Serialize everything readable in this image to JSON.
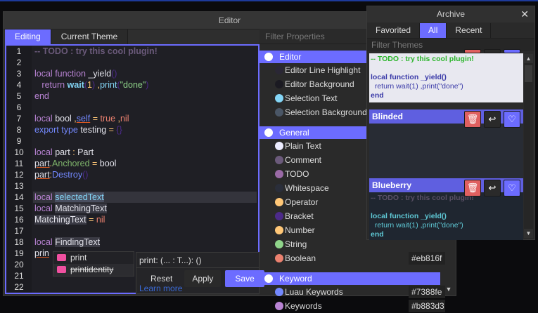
{
  "editor": {
    "title": "Editor",
    "tabs": [
      "Editing",
      "Current Theme"
    ],
    "lines": [
      [
        {
          "t": "-- TODO : try this cool plugin!",
          "c": "cm b"
        }
      ],
      [],
      [
        {
          "t": "local ",
          "c": "k"
        },
        {
          "t": "function ",
          "c": "k"
        },
        {
          "t": "_yield",
          "c": "pl"
        },
        {
          "t": "()",
          "c": "br"
        }
      ],
      [
        {
          "t": "   return ",
          "c": "k"
        },
        {
          "t": "wait",
          "c": "fn b"
        },
        {
          "t": "(",
          "c": "br"
        },
        {
          "t": "1",
          "c": "num"
        },
        {
          "t": ") ",
          "c": "br"
        },
        {
          "t": ",",
          "c": "op"
        },
        {
          "t": "print",
          "c": "fn"
        },
        {
          "t": "(",
          "c": "br"
        },
        {
          "t": "\"done\"",
          "c": "str"
        },
        {
          "t": ")",
          "c": "br"
        }
      ],
      [
        {
          "t": "end",
          "c": "k"
        }
      ],
      [],
      [
        {
          "t": "local ",
          "c": "k"
        },
        {
          "t": "bool ",
          "c": "pl"
        },
        {
          "t": ",",
          "c": "op"
        },
        {
          "t": "self",
          "c": "me ul"
        },
        {
          "t": " = ",
          "c": "op"
        },
        {
          "t": "true ",
          "c": "bool"
        },
        {
          "t": ",",
          "c": "op"
        },
        {
          "t": "nil",
          "c": "bool"
        }
      ],
      [
        {
          "t": "export ",
          "c": "lk"
        },
        {
          "t": "type ",
          "c": "lk"
        },
        {
          "t": "testing ",
          "c": "pl"
        },
        {
          "t": "= ",
          "c": "op"
        },
        {
          "t": "{}",
          "c": "br"
        }
      ],
      [],
      [
        {
          "t": "local ",
          "c": "k"
        },
        {
          "t": "part ",
          "c": "pl"
        },
        {
          "t": ": ",
          "c": "op"
        },
        {
          "t": "Part",
          "c": "pl"
        }
      ],
      [
        {
          "t": "part",
          "c": "pl ul"
        },
        {
          "t": ".",
          "c": "op"
        },
        {
          "t": "Anchored",
          "c": "prop"
        },
        {
          "t": " = ",
          "c": "op"
        },
        {
          "t": "bool",
          "c": "pl"
        }
      ],
      [
        {
          "t": "part",
          "c": "pl ul"
        },
        {
          "t": ":",
          "c": "op"
        },
        {
          "t": "Destroy",
          "c": "me"
        },
        {
          "t": "()",
          "c": "br"
        }
      ],
      [],
      [
        {
          "t": "local ",
          "c": "k"
        },
        {
          "t": "selectedText",
          "c": "sel"
        }
      ],
      [
        {
          "t": "local ",
          "c": "k"
        },
        {
          "t": "MatchingText",
          "c": "pl mt"
        }
      ],
      [
        {
          "t": "MatchingText",
          "c": "pl mt"
        },
        {
          "t": " = ",
          "c": "op"
        },
        {
          "t": "nil",
          "c": "bool"
        }
      ],
      [],
      [
        {
          "t": "local ",
          "c": "k"
        },
        {
          "t": "FindingText",
          "c": "pl mt"
        }
      ],
      [
        {
          "t": "prin",
          "c": "pl ul"
        }
      ],
      [],
      [],
      []
    ],
    "autocomplete": [
      "print",
      "printidentity"
    ],
    "tooltip": {
      "signature": "print: (... : T...): ()",
      "learn_more": "Learn more"
    },
    "buttons": {
      "reset": "Reset",
      "apply": "Apply",
      "save": "Save"
    }
  },
  "properties": {
    "filter_placeholder": "Filter Properties",
    "groups": [
      {
        "name": "Editor",
        "items": [
          {
            "label": "Editor Line Highlight",
            "color": "#2a2735"
          },
          {
            "label": "Editor Background",
            "color": "#1b1a22"
          },
          {
            "label": "Selection Text",
            "color": "#84d6f7"
          },
          {
            "label": "Selection Background",
            "color": "#4a5666"
          }
        ]
      },
      {
        "name": "General",
        "items": [
          {
            "label": "Plain Text",
            "color": "#ececff"
          },
          {
            "label": "Comment",
            "color": "#6b5a7b"
          },
          {
            "label": "TODO",
            "color": "#9a6aa6"
          },
          {
            "label": "Whitespace",
            "color": "#2a2e3a"
          },
          {
            "label": "Operator",
            "color": "#ffc777"
          },
          {
            "label": "Bracket",
            "color": "#4c2a8a"
          },
          {
            "label": "Number",
            "color": "#ffc777"
          },
          {
            "label": "String",
            "color": "#8fd48a"
          },
          {
            "label": "Boolean",
            "color": "#eb816f",
            "hex": "#eb816f"
          }
        ]
      },
      {
        "name": "Keyword",
        "items": [
          {
            "label": "Luau Keywords",
            "color": "#7388fe",
            "hex": "#7388fe"
          },
          {
            "label": "Keywords",
            "color": "#b883d3",
            "hex": "#b883d3"
          }
        ]
      }
    ]
  },
  "archive": {
    "title": "Archive",
    "tabs": [
      "Favorited",
      "All",
      "Recent"
    ],
    "filter_placeholder": "Filter Themes",
    "themes": [
      {
        "name": "",
        "preview": [
          "-- TODO : try this cool plugin!",
          "",
          "local function _yield()",
          "  return wait(1) ,print(\"done\")",
          "end"
        ]
      },
      {
        "name": "Blinded"
      },
      {
        "name": "Blueberry",
        "preview": [
          "-- TODO : try this cool plugin!",
          "",
          "local function _yield()",
          "  return wait(1) ,print(\"done\")",
          "end"
        ]
      }
    ]
  }
}
